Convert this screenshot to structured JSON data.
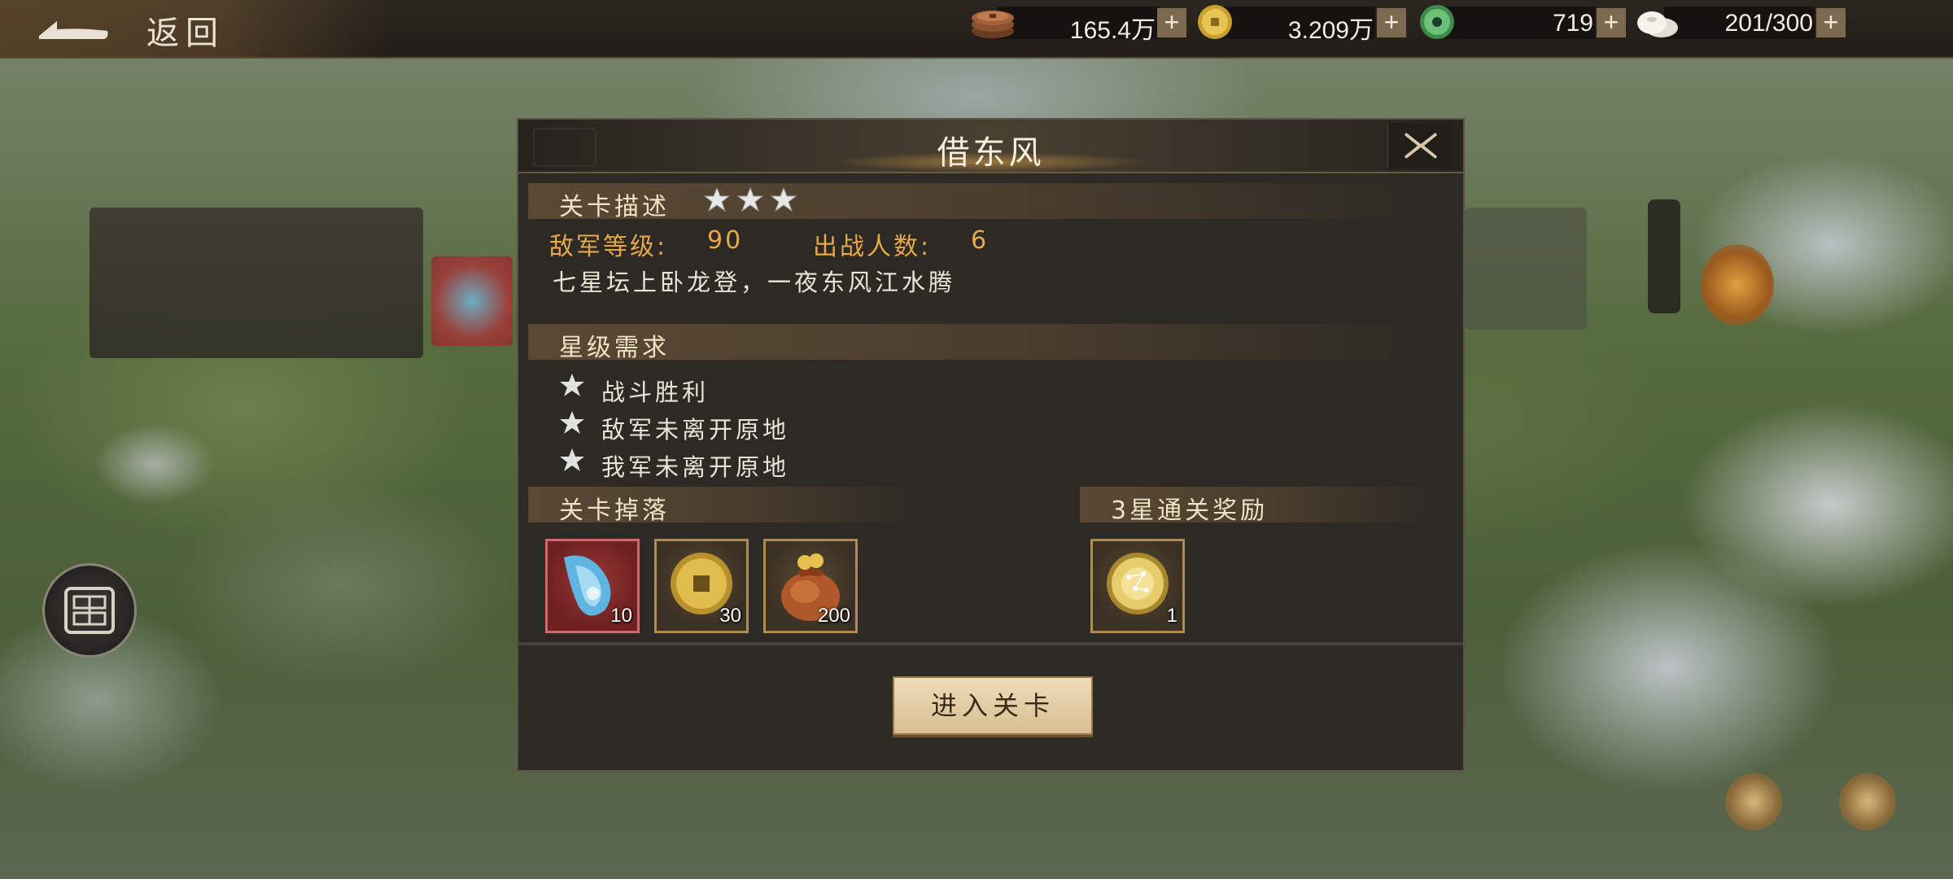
{
  "topbar": {
    "back_label": "返回",
    "resources": [
      {
        "name": "copper-coins",
        "value": "165.4万",
        "plus": "+"
      },
      {
        "name": "gold-coin",
        "value": "3.209万",
        "plus": "+"
      },
      {
        "name": "jade",
        "value": "719",
        "plus": "+"
      },
      {
        "name": "stamina",
        "value": "201/300",
        "plus": "+"
      }
    ]
  },
  "modal": {
    "title": "借东风",
    "description_section": {
      "label": "关卡描述",
      "stars": 3,
      "enemy_level_label": "敌军等级:",
      "enemy_level_value": "90",
      "battle_count_label": "出战人数:",
      "battle_count_value": "6",
      "description": "七星坛上卧龙登，一夜东风江水腾"
    },
    "requirements_section": {
      "label": "星级需求",
      "items": [
        "战斗胜利",
        "敌军未离开原地",
        "我军未离开原地"
      ]
    },
    "drops_section": {
      "label": "关卡掉落",
      "items": [
        {
          "icon": "blue-crystal-icon",
          "count": "10"
        },
        {
          "icon": "gold-coin-icon",
          "count": "30"
        },
        {
          "icon": "money-bag-icon",
          "count": "200"
        }
      ]
    },
    "reward_section": {
      "label": "3星通关奖励",
      "items": [
        {
          "icon": "star-orb-icon",
          "count": "1"
        }
      ]
    },
    "enter_button": "进入关卡"
  },
  "colors": {
    "accent_orange": "#e7a84c",
    "button_face": "#e6d1a8",
    "panel_bg": "#2d2a25"
  }
}
